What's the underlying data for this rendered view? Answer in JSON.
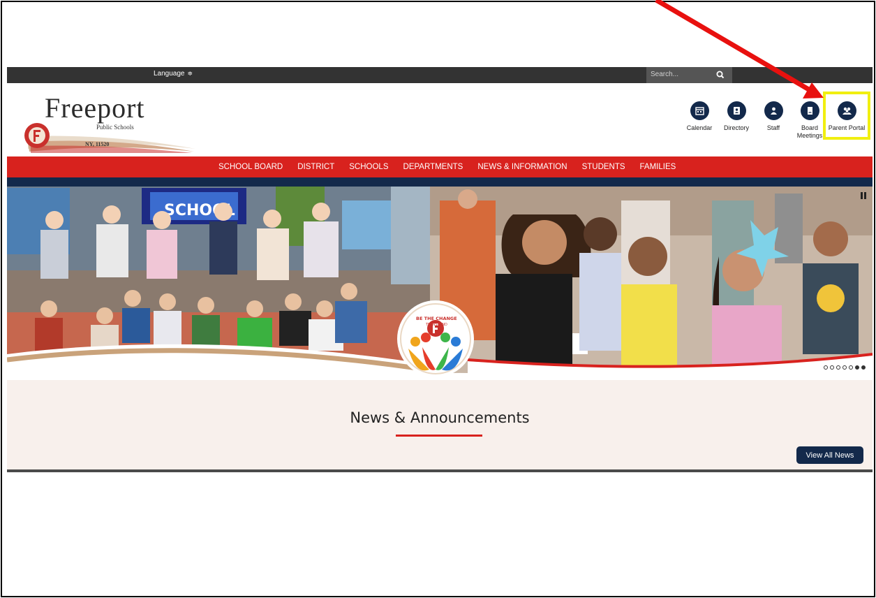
{
  "utility_bar": {
    "language_label": "Language",
    "language_arrow": "≑",
    "search_placeholder": "Search..."
  },
  "logo": {
    "title": "Freeport",
    "subtitle": "Public Schools",
    "location": "NY, 11520"
  },
  "quick_links": [
    {
      "label": "Calendar",
      "icon": "calendar-icon"
    },
    {
      "label": "Directory",
      "icon": "directory-icon"
    },
    {
      "label": "Staff",
      "icon": "staff-icon"
    },
    {
      "label": "Board Meetings",
      "icon": "board-meetings-icon"
    },
    {
      "label": "Parent Portal",
      "icon": "parent-portal-icon"
    }
  ],
  "nav": {
    "items": [
      "SCHOOL BOARD",
      "DISTRICT",
      "SCHOOLS",
      "DEPARTMENTS",
      "NEWS & INFORMATION",
      "STUDENTS",
      "FAMILIES"
    ]
  },
  "hero": {
    "badge_text_top": "BE THE CHANGE",
    "badge_text_bottom": "TRANSCEND",
    "classroom_sign": "SCHOOL",
    "slide_count": 7,
    "active_slide": 7
  },
  "news": {
    "title": "News & Announcements",
    "view_all_label": "View All News"
  },
  "colors": {
    "brand_red": "#d8221e",
    "brand_navy": "#13294b",
    "annotation_red": "#e8110f",
    "annotation_yellow": "#f1ef10"
  }
}
